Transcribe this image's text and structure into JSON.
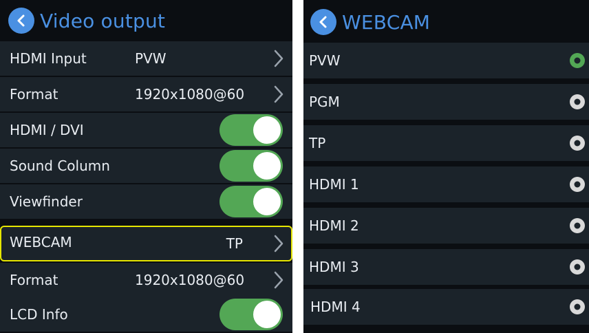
{
  "left": {
    "title": "Video output",
    "items": [
      {
        "label": "HDMI Input",
        "value": "PVW",
        "type": "chevron"
      },
      {
        "label": "Format",
        "value": "1920x1080@60",
        "type": "chevron"
      },
      {
        "label": "HDMI / DVI",
        "type": "toggle",
        "on": true
      },
      {
        "label": "Sound Column",
        "type": "toggle",
        "on": true
      },
      {
        "label": "Viewfinder",
        "type": "toggle",
        "on": true
      },
      {
        "label": "WEBCAM",
        "value": "TP",
        "type": "chevron",
        "highlighted": true
      },
      {
        "label": "Format",
        "value": "1920x1080@60",
        "type": "chevron"
      },
      {
        "label": "LCD Info",
        "type": "toggle",
        "on": true
      }
    ]
  },
  "right": {
    "title": "WEBCAM",
    "options": [
      "PVW",
      "PGM",
      "TP",
      "HDMI 1",
      "HDMI 2",
      "HDMI 3",
      "HDMI 4"
    ],
    "selected": "PVW"
  },
  "colors": {
    "accent_blue": "#4a90e2",
    "toggle_green": "#53a755",
    "row_bg": "#1b232a",
    "panel_bg": "#0b0e12",
    "highlight_yellow": "#e6e600",
    "radio_selected": "#53a755",
    "radio_unselected": "#d9d9d9"
  },
  "icons": {
    "back": "back-arrow-icon",
    "chevron": "chevron-right-icon",
    "toggle": "toggle-switch",
    "radio": "radio-button"
  }
}
